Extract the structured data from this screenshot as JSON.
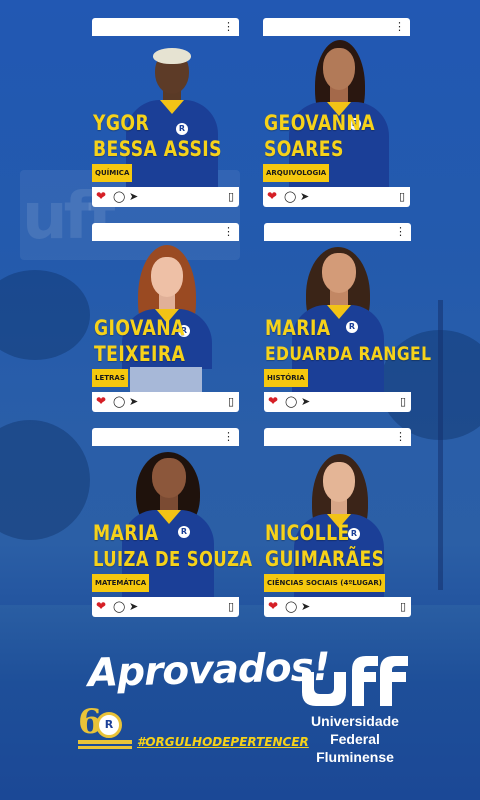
{
  "headline": "Aprovados!",
  "hashtag": "#ORGULHODEPERTENCER",
  "university": {
    "line1": "Universidade",
    "line2": "Federal",
    "line3": "Fluminense"
  },
  "logo_badge_number": "60",
  "colors": {
    "background": "#2258b3",
    "name_yellow": "#f6d21a",
    "tag_yellow": "#f5c80e",
    "shirt_blue": "#1b3f97",
    "heart_red": "#d51f26"
  },
  "icons": [
    "more-dots-icon",
    "heart-icon",
    "comment-icon",
    "share-icon",
    "bookmark-icon"
  ],
  "cards": [
    {
      "name_line1": "YGOR",
      "name_line2": "BESSA ASSIS",
      "course": "QUÍMICA"
    },
    {
      "name_line1": "GEOVANNA",
      "name_line2": "SOARES",
      "course": "ARQUIVOLOGIA"
    },
    {
      "name_line1": "GIOVANA",
      "name_line2": "TEIXEIRA",
      "course": "LETRAS"
    },
    {
      "name_line1": "MARIA",
      "name_line2": "EDUARDA RANGEL",
      "course": "HISTÓRIA"
    },
    {
      "name_line1": "MARIA",
      "name_line2": "LUIZA DE SOUZA",
      "course": "MATEMÁTICA"
    },
    {
      "name_line1": "NICOLLE",
      "name_line2": "GUIMARÃES",
      "course": "CIÊNCIAS SOCIAIS (4ºLUGAR)"
    }
  ]
}
